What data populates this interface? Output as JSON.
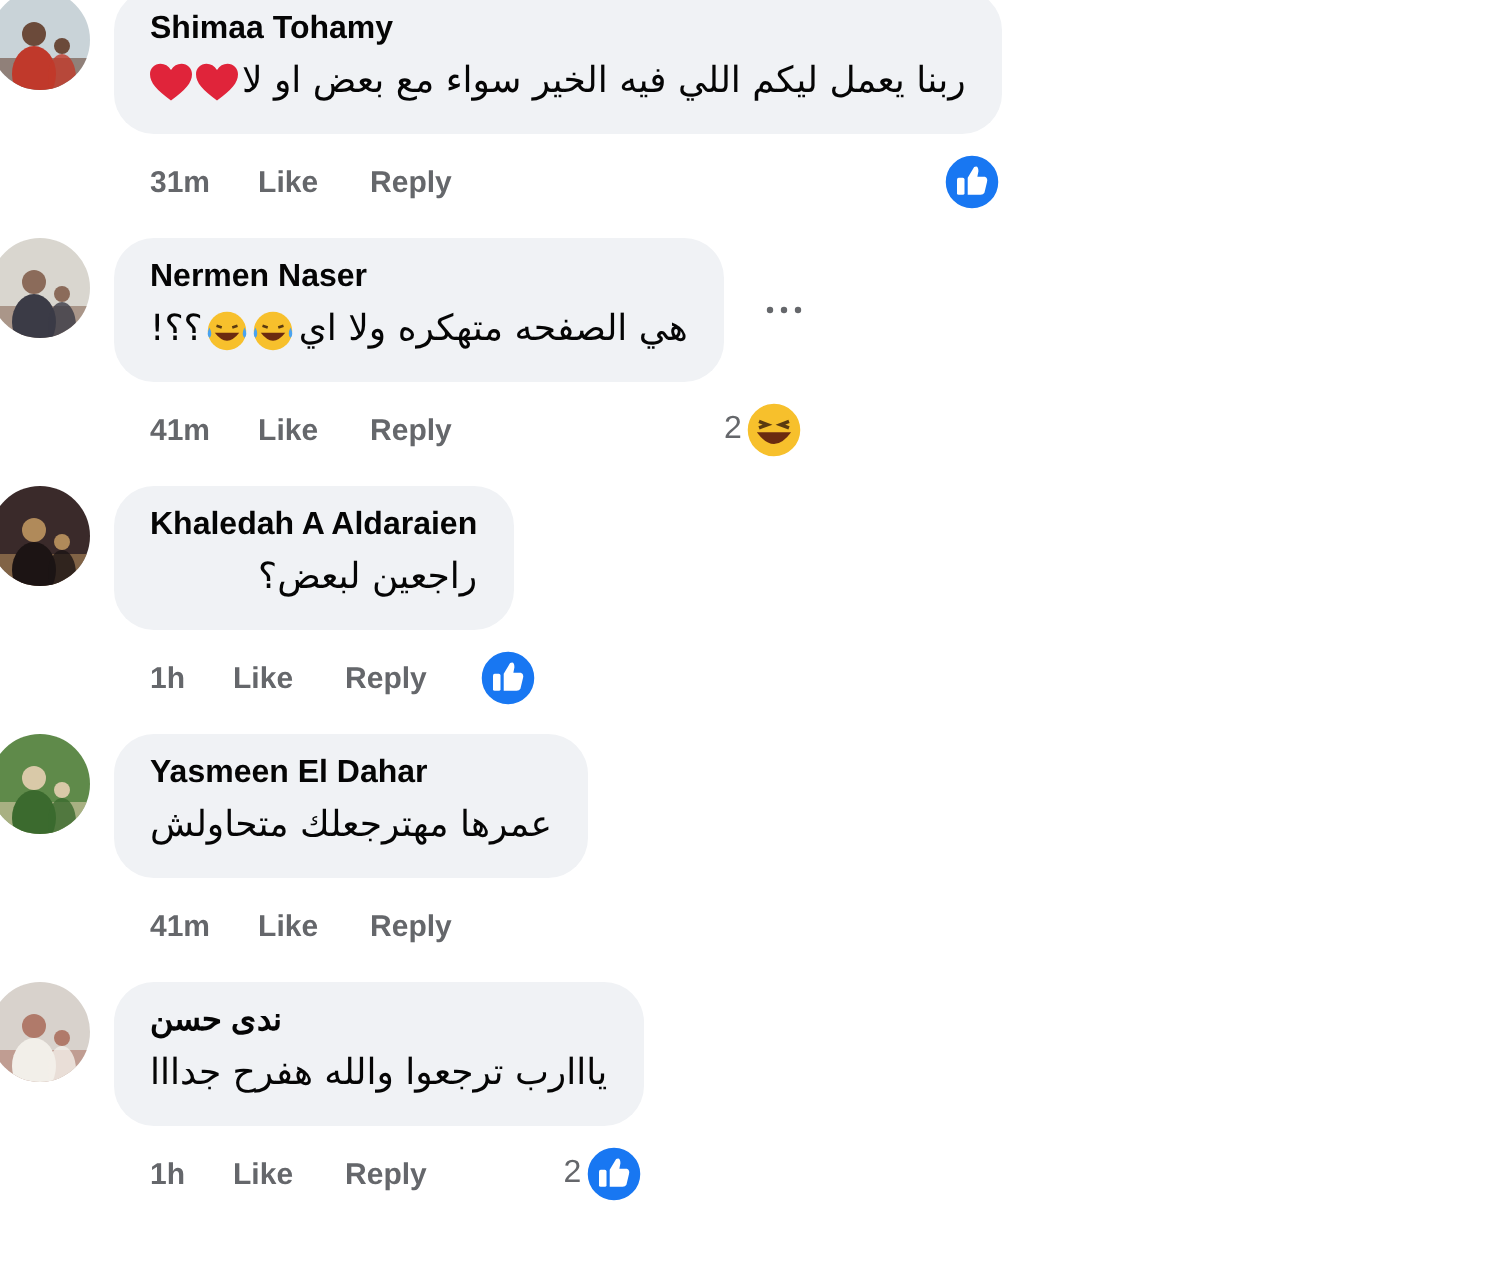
{
  "comments": [
    {
      "name": "Shimaa Tohamy",
      "content": [
        {
          "kind": "text",
          "text": "ربنا يعمل ليكم اللي فيه الخير سواء مع بعض او لا"
        },
        {
          "kind": "heart"
        },
        {
          "kind": "heart"
        }
      ],
      "time": "31m",
      "like": "Like",
      "reply": "Reply",
      "reaction": {
        "kind": "like"
      },
      "more_menu": false
    },
    {
      "name": "Nermen Naser",
      "content": [
        {
          "kind": "text",
          "text": "هي الصفحه متهكره ولا اي"
        },
        {
          "kind": "laugh"
        },
        {
          "kind": "laugh"
        },
        {
          "kind": "text",
          "text": "؟؟!"
        }
      ],
      "time": "41m",
      "like": "Like",
      "reply": "Reply",
      "reaction": {
        "kind": "haha",
        "count": "2"
      },
      "more_menu": true
    },
    {
      "name": "Khaledah A Aldaraien",
      "content": [
        {
          "kind": "text",
          "text": "راجعين لبعض؟"
        }
      ],
      "time": "1h",
      "like": "Like",
      "reply": "Reply",
      "reaction": {
        "kind": "like"
      },
      "more_menu": false
    },
    {
      "name": "Yasmeen El Dahar",
      "content": [
        {
          "kind": "text",
          "text": "عمرها مهترجعلك متحاولش"
        }
      ],
      "time": "41m",
      "like": "Like",
      "reply": "Reply",
      "more_menu": false
    },
    {
      "name": "ندى حسن",
      "content": [
        {
          "kind": "text",
          "text": "يااارب ترجعوا والله هفرح جدااا"
        }
      ],
      "time": "1h",
      "like": "Like",
      "reply": "Reply",
      "reaction": {
        "kind": "like",
        "count": "2"
      },
      "more_menu": false
    }
  ]
}
